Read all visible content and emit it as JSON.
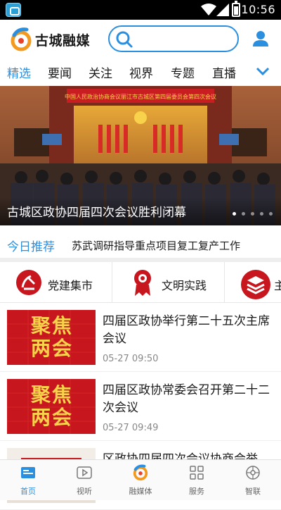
{
  "status_bar": {
    "time": "10:56"
  },
  "header": {
    "brand": "古城融媒",
    "search_placeholder": ""
  },
  "tabs": [
    "精选",
    "要闻",
    "关注",
    "视界",
    "专题",
    "直播"
  ],
  "active_tab": "精选",
  "banner": {
    "caption": "古城区政协四届四次会议胜利闭幕",
    "stage_banner": "中国人民政治协商会议丽江市古城区第四届委员会第四次会议",
    "slides": 5,
    "current_slide": 1
  },
  "recommend": {
    "label": "今日推荐",
    "text": "苏武调研指导重点项目复工复产工作"
  },
  "channels": [
    {
      "label": "党建集市",
      "icon": "party-emblem-icon"
    },
    {
      "label": "文明实践",
      "icon": "civilization-medal-icon"
    },
    {
      "label": "主",
      "icon": "stack-icon"
    }
  ],
  "news": [
    {
      "thumb_line1": "聚焦",
      "thumb_line2": "两会",
      "title": "四届区政协举行第二十五次主席会议",
      "time": "05-27 09:50"
    },
    {
      "thumb_line1": "聚焦",
      "thumb_line2": "两会",
      "title": "四届区政协常委会召开第二十二次会议",
      "time": "05-27 09:49"
    },
    {
      "thumb_line1": "",
      "thumb_line2": "",
      "title": "区政协四届四次会议协商会举",
      "time": ""
    }
  ],
  "bottom_nav": [
    {
      "label": "首页",
      "icon": "home-icon",
      "active": true
    },
    {
      "label": "视听",
      "icon": "video-icon",
      "active": false
    },
    {
      "label": "融媒体",
      "icon": "media-logo-icon",
      "active": false
    },
    {
      "label": "服务",
      "icon": "grid-icon",
      "active": false
    },
    {
      "label": "智联",
      "icon": "link-icon",
      "active": false
    }
  ],
  "colors": {
    "accent": "#2b8fe0",
    "party_red": "#c8161e",
    "thumb_gold": "#f7d24a"
  }
}
